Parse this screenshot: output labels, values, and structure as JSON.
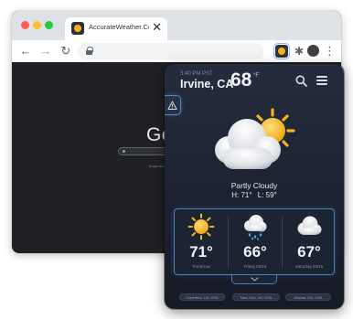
{
  "browser": {
    "tab_title": "AccurateWeather.Com",
    "tab_close": "✕",
    "nav": {
      "back": "←",
      "forward": "→",
      "reload": "↻"
    },
    "menu_glyph": "⋮",
    "puzzle_glyph": "✱"
  },
  "page": {
    "logo_text": "Go",
    "buttons_text": "Google Search  I'm Feeling Lucky"
  },
  "weather": {
    "time": "3:40 PM PST",
    "city": "Irvine, CA",
    "temp": "68",
    "unit": "°F",
    "condition": "Partly Cloudy",
    "high": "H: 71°",
    "low": "L: 59°",
    "forecast": [
      {
        "temp": "71°",
        "label": "Tomorrow",
        "icon": "sun-icon"
      },
      {
        "temp": "66°",
        "label": "Friday 03/15",
        "icon": "rain-cloud-icon"
      },
      {
        "temp": "67°",
        "label": "Saturday 03/16",
        "icon": "cloud-icon"
      }
    ],
    "locations": [
      "Cupertino, CA, USA",
      "New York, NY, USA",
      "Atlanta, GA, USA"
    ]
  },
  "colors": {
    "accent": "#4a7fbf",
    "sun": "#f6b21b",
    "popup_bg": "#1c2230"
  }
}
